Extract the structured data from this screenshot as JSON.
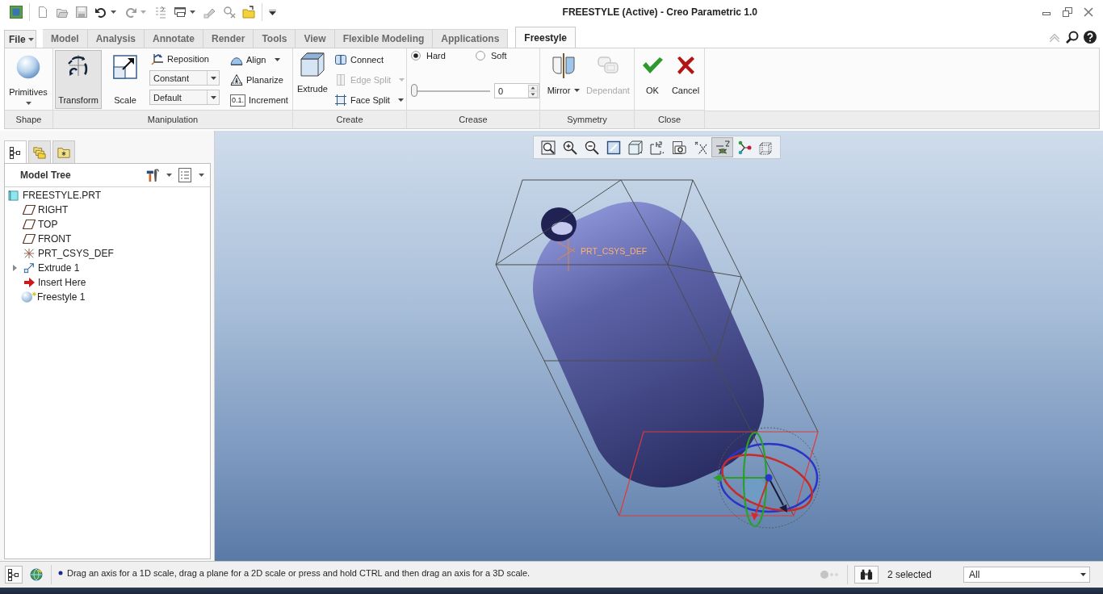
{
  "window": {
    "title": "FREESTYLE (Active) - Creo Parametric 1.0"
  },
  "ribbon": {
    "file_menu": "File",
    "tabs": [
      {
        "label": "Model",
        "selected": false
      },
      {
        "label": "Analysis",
        "selected": false
      },
      {
        "label": "Annotate",
        "selected": false
      },
      {
        "label": "Render",
        "selected": false
      },
      {
        "label": "Tools",
        "selected": false
      },
      {
        "label": "View",
        "selected": false
      },
      {
        "label": "Flexible Modeling",
        "selected": false
      },
      {
        "label": "Applications",
        "selected": false
      },
      {
        "label": "Freestyle",
        "selected": true
      }
    ],
    "shape": {
      "label": "Shape",
      "primitives": "Primitives"
    },
    "manipulation": {
      "label": "Manipulation",
      "tools": [
        {
          "kind": "transform",
          "label": "Transform",
          "selected": true
        },
        {
          "kind": "scale",
          "label": "Scale",
          "selected": false
        }
      ],
      "reposition": "Reposition",
      "dropdowns": [
        "Constant",
        "Default"
      ],
      "actions": [
        {
          "kind": "align",
          "label": "Align"
        },
        {
          "kind": "planarize",
          "label": "Planarize"
        },
        {
          "kind": "increment",
          "label": "Increment",
          "icon_text": "0.1."
        }
      ]
    },
    "create": {
      "label": "Create",
      "extrude": "Extrude",
      "actions": [
        {
          "kind": "connect",
          "label": "Connect",
          "disabled": false
        },
        {
          "kind": "edgesplit",
          "label": "Edge Split",
          "disabled": true
        },
        {
          "kind": "facesplit",
          "label": "Face Split",
          "disabled": false
        }
      ]
    },
    "crease": {
      "label": "Crease",
      "modes": [
        {
          "label": "Hard",
          "selected": true
        },
        {
          "label": "Soft",
          "selected": false
        }
      ],
      "slider": {
        "level": 0
      },
      "value": "0"
    },
    "symmetry": {
      "label": "Symmetry",
      "actions": [
        {
          "kind": "mirror",
          "label": "Mirror",
          "disabled": false
        },
        {
          "kind": "dependant",
          "label": "Dependant",
          "disabled": true
        }
      ]
    },
    "close": {
      "label": "Close",
      "actions": [
        {
          "kind": "ok",
          "label": "OK"
        },
        {
          "kind": "cancel",
          "label": "Cancel"
        }
      ]
    }
  },
  "navigator": {
    "tabs": [
      {
        "kind": "tree",
        "selected": true
      },
      {
        "kind": "folders",
        "selected": false
      },
      {
        "kind": "favorites",
        "selected": false
      }
    ],
    "title": "Model Tree",
    "tree": {
      "kind": "part",
      "label": "FREESTYLE.PRT",
      "children": [
        {
          "kind": "plane",
          "label": "RIGHT"
        },
        {
          "kind": "plane",
          "label": "TOP"
        },
        {
          "kind": "plane",
          "label": "FRONT"
        },
        {
          "kind": "csys",
          "label": "PRT_CSYS_DEF"
        },
        {
          "kind": "extrude",
          "label": "Extrude 1",
          "expanded": false
        },
        {
          "kind": "insert",
          "label": "Insert Here"
        },
        {
          "kind": "freestyle",
          "label": "Freestyle 1"
        }
      ]
    }
  },
  "viewport": {
    "toolbar": [
      {
        "kind": "refit",
        "selected": false
      },
      {
        "kind": "zoomin",
        "selected": false
      },
      {
        "kind": "zoomout",
        "selected": false
      },
      {
        "kind": "repaint",
        "selected": false
      },
      {
        "kind": "style",
        "selected": false
      },
      {
        "kind": "orient",
        "selected": false
      },
      {
        "kind": "camera",
        "selected": false
      },
      {
        "kind": "axes",
        "selected": false
      },
      {
        "kind": "planes",
        "selected": true
      },
      {
        "kind": "nodes",
        "selected": false
      },
      {
        "kind": "box",
        "selected": false
      }
    ],
    "csys_label": "PRT_CSYS_DEF"
  },
  "status_bar": {
    "message": "Drag an axis for a 1D scale, drag a plane for a 2D scale or press and hold CTRL and then drag an axis for a 3D scale.",
    "selection": "2 selected",
    "filter": "All"
  }
}
